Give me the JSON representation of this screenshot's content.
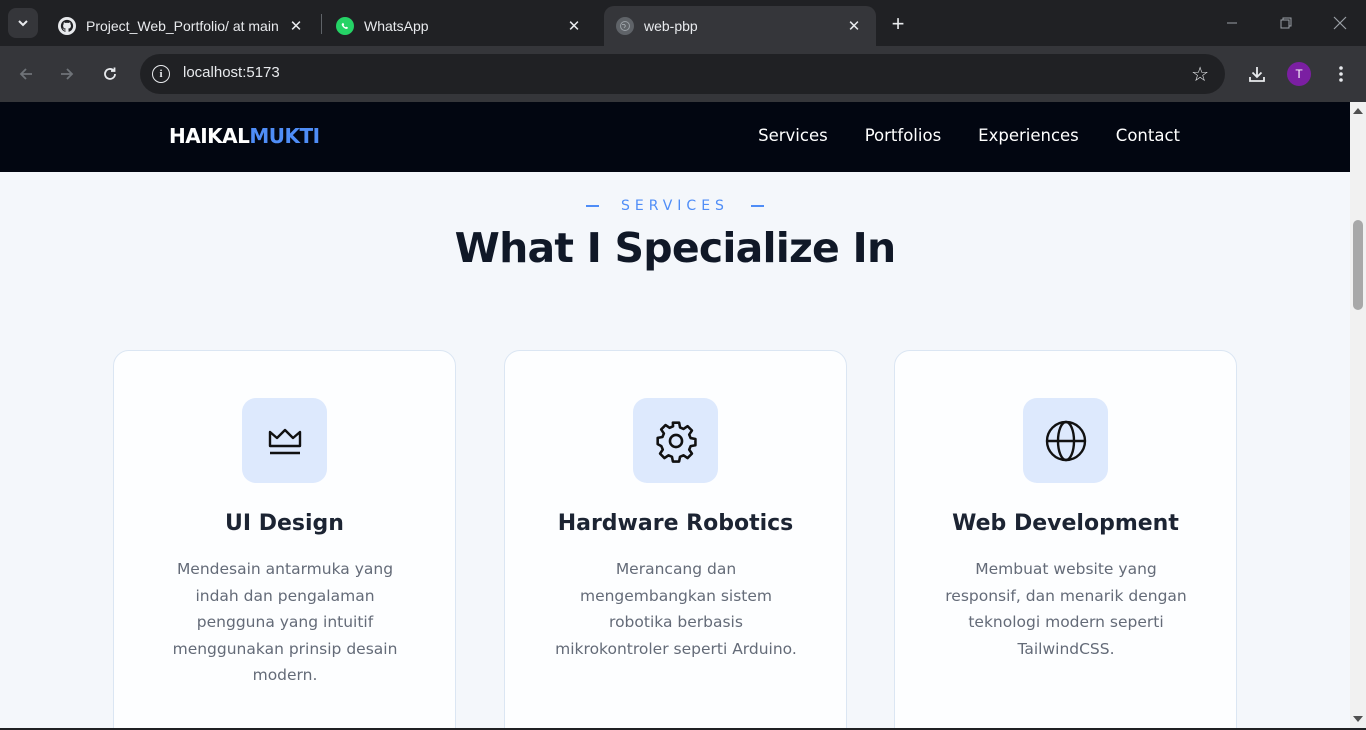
{
  "browser": {
    "tabs": [
      {
        "title": "Project_Web_Portfolio/ at main",
        "icon": "github-icon",
        "active": false
      },
      {
        "title": "WhatsApp",
        "icon": "whatsapp-icon",
        "active": false
      },
      {
        "title": "web-pbp",
        "icon": "globe-icon",
        "active": true
      }
    ],
    "url": "localhost:5173",
    "profile_initial": "T",
    "profile_color": "#7b1fa2"
  },
  "site": {
    "brand_first": "HAIKAL",
    "brand_second": "MUKTI",
    "brand_accent_color": "#4f8df7",
    "nav": [
      "Services",
      "Portfolios",
      "Experiences",
      "Contact"
    ]
  },
  "section": {
    "eyebrow": "SERVICES",
    "heading": "What I Specialize In"
  },
  "cards": [
    {
      "icon": "crown-icon",
      "title": "UI Design",
      "description": "Mendesain antarmuka yang indah dan pengalaman pengguna yang intuitif menggunakan prinsip desain modern."
    },
    {
      "icon": "gear-icon",
      "title": "Hardware Robotics",
      "description": "Merancang dan mengembangkan sistem robotika berbasis mikrokontroler seperti Arduino."
    },
    {
      "icon": "globe-icon",
      "title": "Web Development",
      "description": "Membuat website yang responsif, dan menarik dengan teknologi modern seperti TailwindCSS."
    }
  ]
}
